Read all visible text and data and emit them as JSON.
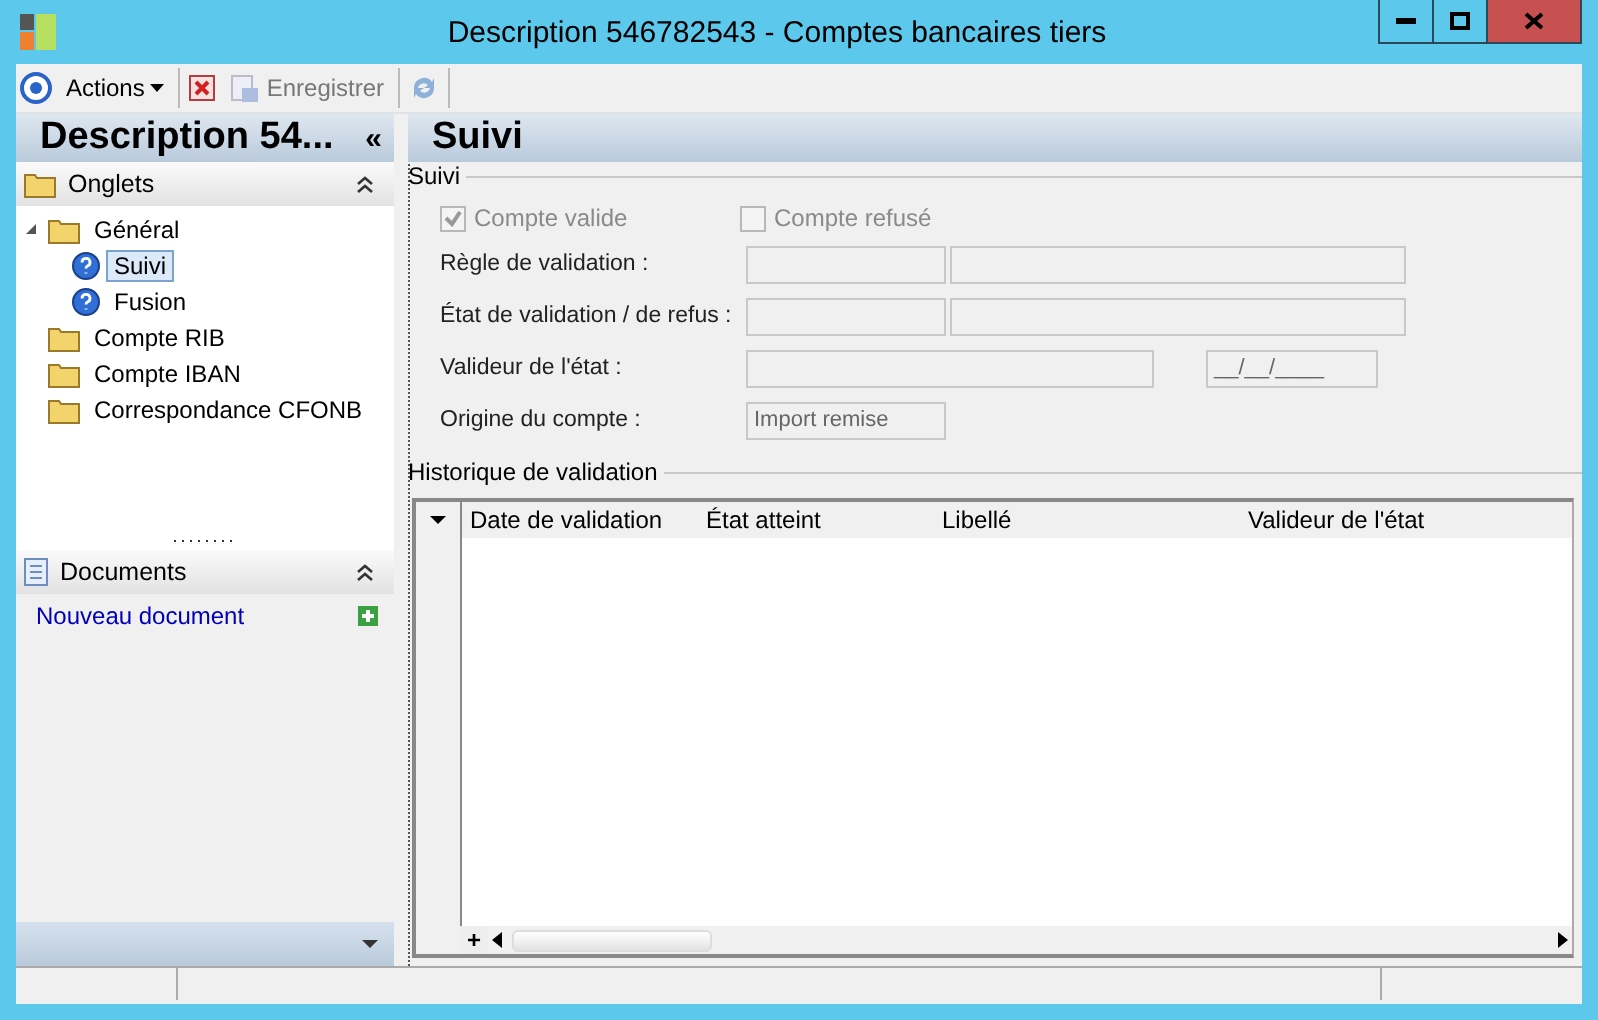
{
  "window": {
    "title": "Description 546782543 -  Comptes bancaires tiers"
  },
  "toolbar": {
    "actions_label": "Actions",
    "save": {
      "label": "Enregistrer",
      "disabled": true
    }
  },
  "left_panel": {
    "title": "Description 54...",
    "collapse_glyph": "«",
    "tabs_section": {
      "title": "Onglets",
      "expanded": true,
      "tree": [
        {
          "label": "Général",
          "kind": "folder",
          "expanded": true,
          "selected": false,
          "children": [
            {
              "label": "Suivi",
              "kind": "page",
              "selected": true
            },
            {
              "label": "Fusion",
              "kind": "page",
              "selected": false
            }
          ]
        },
        {
          "label": "Compte RIB",
          "kind": "folder",
          "selected": false
        },
        {
          "label": "Compte IBAN",
          "kind": "folder",
          "selected": false
        },
        {
          "label": "Correspondance CFONB",
          "kind": "folder",
          "selected": false
        }
      ]
    },
    "documents_section": {
      "title": "Documents",
      "expanded": true,
      "link": "Nouveau document"
    }
  },
  "content": {
    "title": "Suivi",
    "suivi_group": {
      "title": "Suivi",
      "checkboxes": [
        {
          "label": "Compte valide",
          "checked": true,
          "disabled": true
        },
        {
          "label": "Compte refusé",
          "checked": false,
          "disabled": true
        }
      ],
      "fields": [
        {
          "label": "Règle de validation :",
          "kind": "pair"
        },
        {
          "label": "État de validation / de refus :",
          "kind": "pair"
        },
        {
          "label": "Valideur de l'état :",
          "kind": "date",
          "date_placeholder": "__/__/____"
        },
        {
          "label": "Origine du compte :",
          "kind": "single",
          "value": "Import remise"
        }
      ]
    },
    "history_group": {
      "title": "Historique de validation",
      "table": {
        "columns": [
          "Date de validation",
          "État atteint",
          "Libellé",
          "Valideur de l'état"
        ],
        "add_glyph": "+"
      }
    }
  }
}
